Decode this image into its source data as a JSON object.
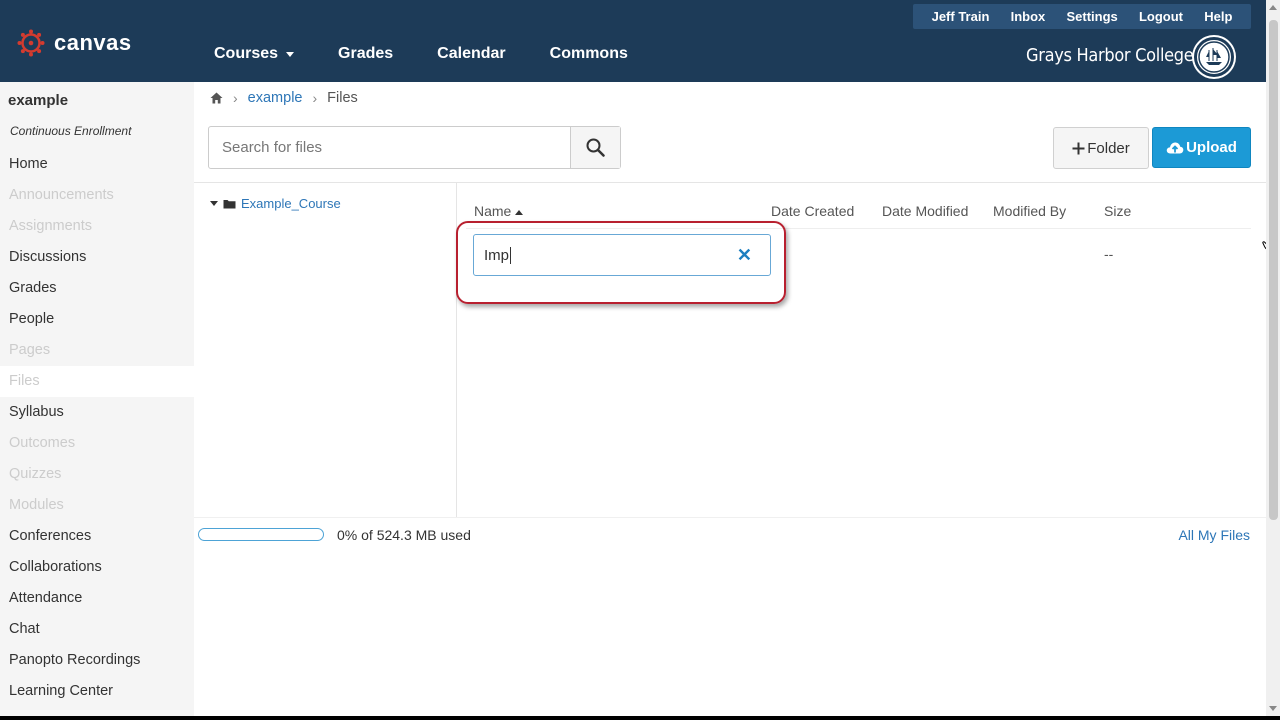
{
  "header": {
    "logo_text": "canvas",
    "nav": [
      "Courses",
      "Grades",
      "Calendar",
      "Commons"
    ],
    "util": [
      "Jeff Train",
      "Inbox",
      "Settings",
      "Logout",
      "Help"
    ],
    "college": "Grays Harbor College"
  },
  "sidebar": {
    "course_name": "example",
    "course_sub": "Continuous Enrollment",
    "items": [
      {
        "label": "Home",
        "state": "normal"
      },
      {
        "label": "Announcements",
        "state": "disabled"
      },
      {
        "label": "Assignments",
        "state": "disabled"
      },
      {
        "label": "Discussions",
        "state": "normal"
      },
      {
        "label": "Grades",
        "state": "normal"
      },
      {
        "label": "People",
        "state": "normal"
      },
      {
        "label": "Pages",
        "state": "disabled"
      },
      {
        "label": "Files",
        "state": "active"
      },
      {
        "label": "Syllabus",
        "state": "normal"
      },
      {
        "label": "Outcomes",
        "state": "disabled"
      },
      {
        "label": "Quizzes",
        "state": "disabled"
      },
      {
        "label": "Modules",
        "state": "disabled"
      },
      {
        "label": "Conferences",
        "state": "normal"
      },
      {
        "label": "Collaborations",
        "state": "normal"
      },
      {
        "label": "Attendance",
        "state": "normal"
      },
      {
        "label": "Chat",
        "state": "normal"
      },
      {
        "label": "Panopto Recordings",
        "state": "normal"
      },
      {
        "label": "Learning Center",
        "state": "normal"
      }
    ]
  },
  "breadcrumb": {
    "course": "example",
    "current": "Files"
  },
  "search": {
    "placeholder": "Search for files"
  },
  "buttons": {
    "folder": "Folder",
    "upload": "Upload"
  },
  "tree": {
    "folder": "Example_Course"
  },
  "columns": {
    "name": "Name",
    "created": "Date Created",
    "modified": "Date Modified",
    "modified_by": "Modified By",
    "size": "Size"
  },
  "new_folder": {
    "value": "Imp",
    "size": "--"
  },
  "quota": {
    "text": "0% of 524.3 MB used",
    "fraction": 0.0,
    "all_files": "All My Files"
  },
  "colors": {
    "header": "#1d3b58",
    "accent": "#1c9ad6",
    "link": "#2d76b7",
    "highlight": "#b8202f"
  }
}
